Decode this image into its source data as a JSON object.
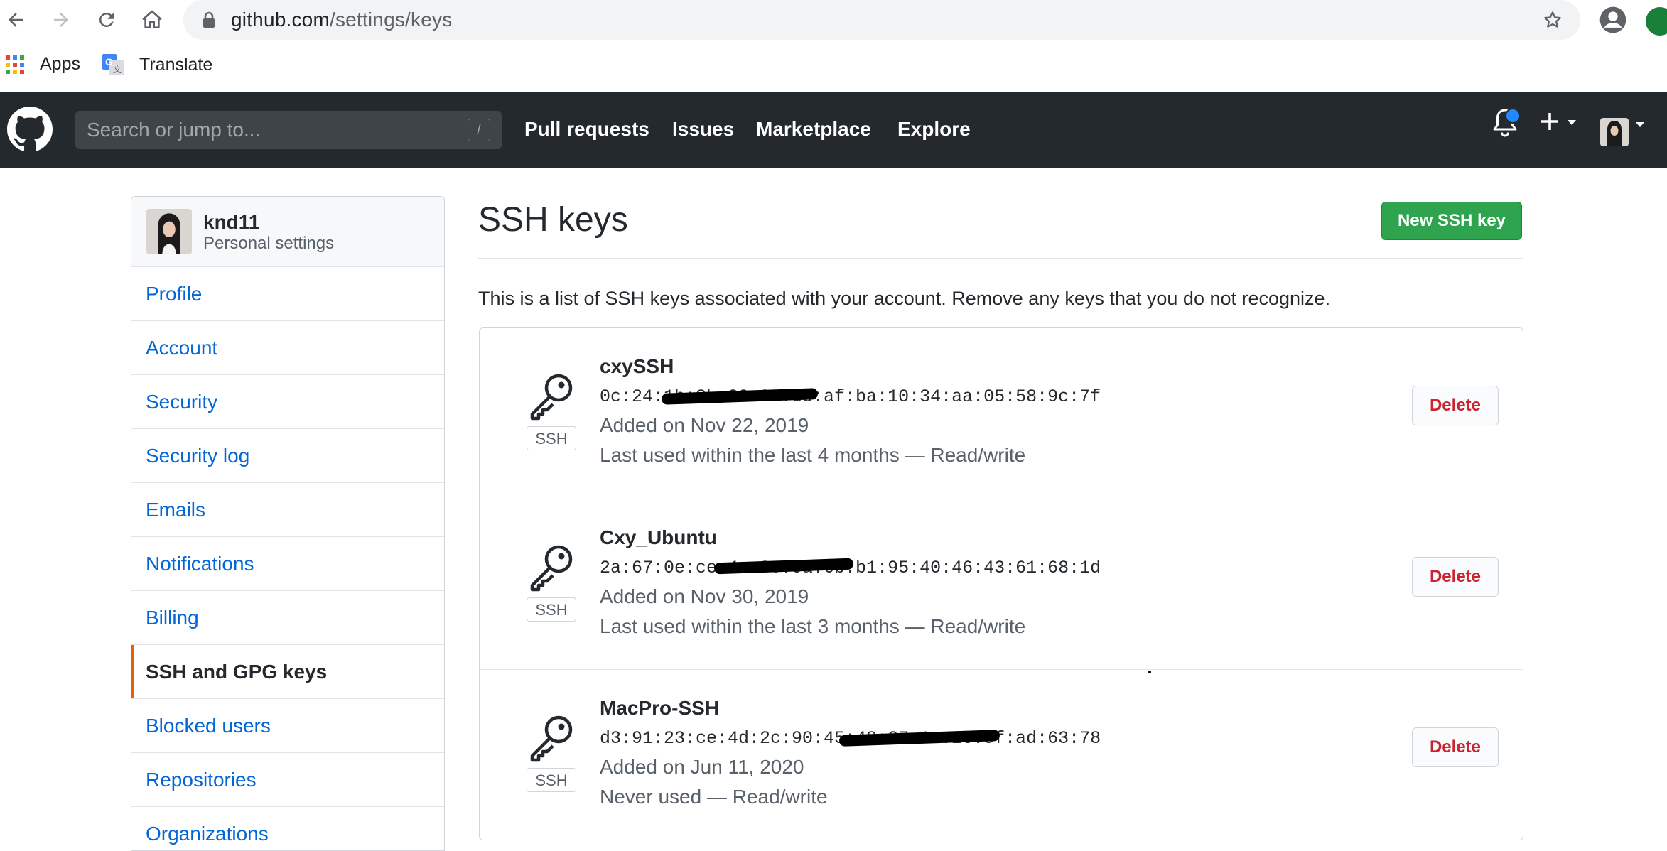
{
  "browser": {
    "url_host": "github.com",
    "url_path": "/settings/keys",
    "bookmarks": [
      {
        "label": "Apps",
        "icon": "apps-grid-icon"
      },
      {
        "label": "Translate",
        "icon": "google-translate-icon"
      }
    ]
  },
  "header": {
    "search_placeholder": "Search or jump to...",
    "search_shortcut": "/",
    "nav": [
      "Pull requests",
      "Issues",
      "Marketplace",
      "Explore"
    ],
    "plus_symbol": "+"
  },
  "sidebar": {
    "username": "knd11",
    "subtitle": "Personal settings",
    "items": [
      {
        "label": "Profile"
      },
      {
        "label": "Account"
      },
      {
        "label": "Security"
      },
      {
        "label": "Security log"
      },
      {
        "label": "Emails"
      },
      {
        "label": "Notifications"
      },
      {
        "label": "Billing"
      },
      {
        "label": "SSH and GPG keys",
        "active": true
      },
      {
        "label": "Blocked users"
      },
      {
        "label": "Repositories"
      },
      {
        "label": "Organizations"
      }
    ]
  },
  "main": {
    "title": "SSH keys",
    "new_key_label": "New SSH key",
    "intro": "This is a list of SSH keys associated with your account. Remove any keys that you do not recognize.",
    "keys": [
      {
        "name": "cxySSH",
        "fingerprint": "0c:24:1b:3b:29:91:d8:af:ba:10:34:aa:05:58:9c:7f",
        "added": "Added on Nov 22, 2019",
        "last_used": "Last used within the last 4 months — Read/write",
        "badge": "SSH",
        "delete_label": "Delete"
      },
      {
        "name": "Cxy_Ubuntu",
        "fingerprint": "2a:67:0e:ce:4a:3c:0a:6b:b1:95:40:46:43:61:68:1d",
        "added": "Added on Nov 30, 2019",
        "last_used": "Last used within the last 3 months — Read/write",
        "badge": "SSH",
        "delete_label": "Delete"
      },
      {
        "name": "MacPro-SSH",
        "fingerprint": "d3:91:23:ce:4d:2c:90:45:48:27:1e:2e:3f:ad:63:78",
        "added": "Added on Jun 11, 2020",
        "last_used": "Never used — Read/write",
        "badge": "SSH",
        "delete_label": "Delete"
      }
    ]
  },
  "colors": {
    "header_bg": "#24292e",
    "link_blue": "#0366d6",
    "primary_green": "#2ea44f",
    "danger_red": "#cb2431",
    "active_marker": "#e36209",
    "notification_dot": "#2188ff"
  }
}
